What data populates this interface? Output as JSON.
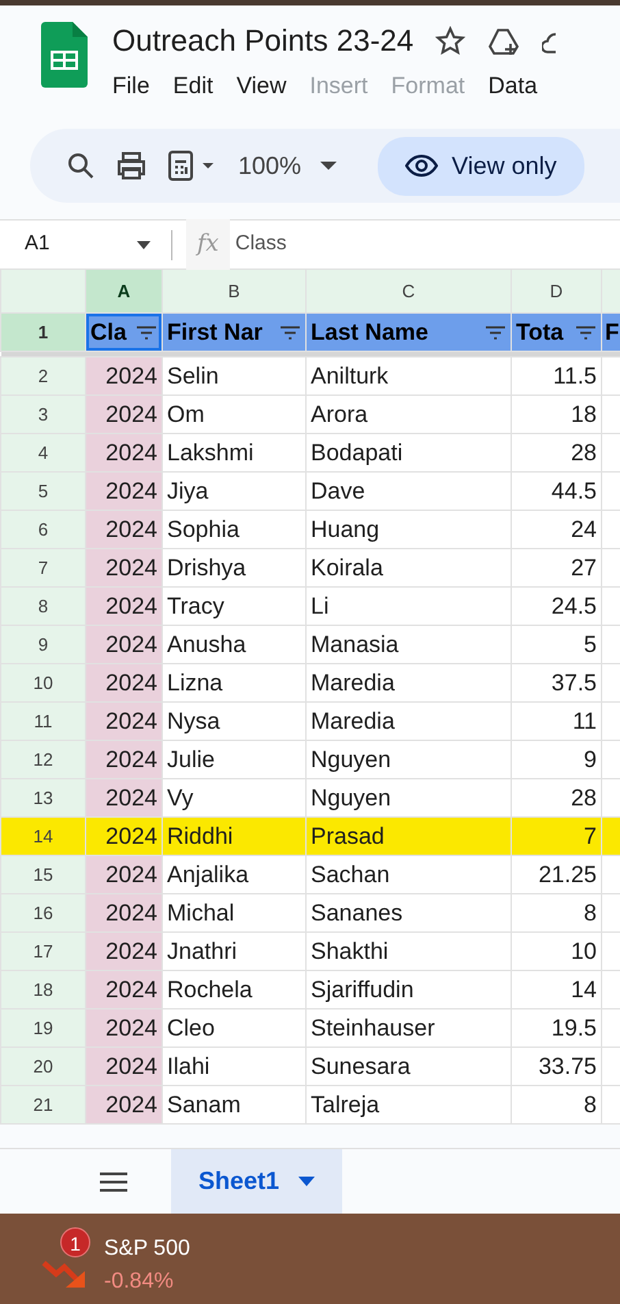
{
  "app": {
    "title": "Outreach Points 23-24",
    "menu": [
      {
        "label": "File",
        "disabled": false
      },
      {
        "label": "Edit",
        "disabled": false
      },
      {
        "label": "View",
        "disabled": false
      },
      {
        "label": "Insert",
        "disabled": true
      },
      {
        "label": "Format",
        "disabled": true
      },
      {
        "label": "Data",
        "disabled": false
      }
    ]
  },
  "toolbar": {
    "zoom": "100%",
    "view_button": "View only"
  },
  "formula_bar": {
    "cell_ref": "A1",
    "fx": "fx",
    "value": "Class"
  },
  "columns": [
    {
      "label": "A",
      "selected": true
    },
    {
      "label": "B",
      "selected": false
    },
    {
      "label": "C",
      "selected": false
    },
    {
      "label": "D",
      "selected": false
    }
  ],
  "header_row": {
    "number": "1",
    "cells": [
      "Cla",
      "First Nar",
      "Last Name",
      "Tota",
      "F"
    ]
  },
  "rows": [
    {
      "number": "2",
      "cells": [
        "2024",
        "Selin",
        "Anilturk",
        "11.5"
      ],
      "highlighted": false
    },
    {
      "number": "3",
      "cells": [
        "2024",
        "Om",
        "Arora",
        "18"
      ],
      "highlighted": false
    },
    {
      "number": "4",
      "cells": [
        "2024",
        "Lakshmi",
        "Bodapati",
        "28"
      ],
      "highlighted": false
    },
    {
      "number": "5",
      "cells": [
        "2024",
        "Jiya",
        "Dave",
        "44.5"
      ],
      "highlighted": false
    },
    {
      "number": "6",
      "cells": [
        "2024",
        "Sophia",
        "Huang",
        "24"
      ],
      "highlighted": false
    },
    {
      "number": "7",
      "cells": [
        "2024",
        "Drishya",
        "Koirala",
        "27"
      ],
      "highlighted": false
    },
    {
      "number": "8",
      "cells": [
        "2024",
        "Tracy",
        "Li",
        "24.5"
      ],
      "highlighted": false
    },
    {
      "number": "9",
      "cells": [
        "2024",
        "Anusha",
        "Manasia",
        "5"
      ],
      "highlighted": false
    },
    {
      "number": "10",
      "cells": [
        "2024",
        "Lizna",
        "Maredia",
        "37.5"
      ],
      "highlighted": false
    },
    {
      "number": "11",
      "cells": [
        "2024",
        "Nysa",
        "Maredia",
        "11"
      ],
      "highlighted": false
    },
    {
      "number": "12",
      "cells": [
        "2024",
        "Julie",
        "Nguyen",
        "9"
      ],
      "highlighted": false
    },
    {
      "number": "13",
      "cells": [
        "2024",
        "Vy",
        "Nguyen",
        "28"
      ],
      "highlighted": false
    },
    {
      "number": "14",
      "cells": [
        "2024",
        "Riddhi",
        "Prasad",
        "7"
      ],
      "highlighted": true
    },
    {
      "number": "15",
      "cells": [
        "2024",
        "Anjalika",
        "Sachan",
        "21.25"
      ],
      "highlighted": false
    },
    {
      "number": "16",
      "cells": [
        "2024",
        "Michal",
        "Sananes",
        "8"
      ],
      "highlighted": false
    },
    {
      "number": "17",
      "cells": [
        "2024",
        "Jnathri",
        "Shakthi",
        "10"
      ],
      "highlighted": false
    },
    {
      "number": "18",
      "cells": [
        "2024",
        "Rochela",
        "Sjariffudin",
        "14"
      ],
      "highlighted": false
    },
    {
      "number": "19",
      "cells": [
        "2024",
        "Cleo",
        "Steinhauser",
        "19.5"
      ],
      "highlighted": false
    },
    {
      "number": "20",
      "cells": [
        "2024",
        "Ilahi",
        "Sunesara",
        "33.75"
      ],
      "highlighted": false
    },
    {
      "number": "21",
      "cells": [
        "2024",
        "Sanam",
        "Talreja",
        "8"
      ],
      "highlighted": false
    }
  ],
  "sheet_tabs": [
    {
      "label": "Sheet1",
      "selected": true
    }
  ],
  "taskbar": {
    "badge": "1",
    "name": "S&P 500",
    "change": "-0.84%"
  }
}
